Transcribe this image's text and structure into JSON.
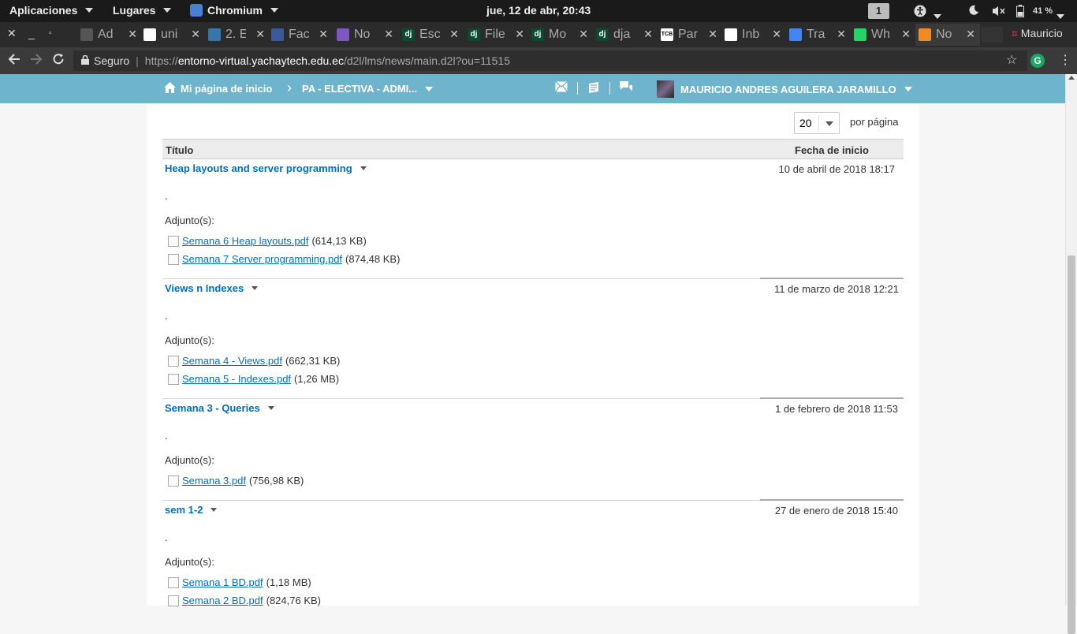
{
  "topbar": {
    "applications": "Aplicaciones",
    "places": "Lugares",
    "app_name": "Chromium",
    "clock": "jue, 12 de abr, 20:43",
    "workspace": "1",
    "battery": "41 %"
  },
  "tabs": [
    {
      "label": "Ad",
      "favicon": "doc-icon",
      "color": "#555"
    },
    {
      "label": "uni",
      "favicon": "google-icon",
      "color": "#fff"
    },
    {
      "label": "2. E",
      "favicon": "python-icon",
      "color": "#3776ab"
    },
    {
      "label": "Fac",
      "favicon": "facebook-icon",
      "color": "#3b5998"
    },
    {
      "label": "No",
      "favicon": "list-icon",
      "color": "#7e57c2"
    },
    {
      "label": "Esc",
      "favicon": "django-icon",
      "color": "#0c4b33"
    },
    {
      "label": "File",
      "favicon": "django-icon",
      "color": "#0c4b33"
    },
    {
      "label": "Mo",
      "favicon": "django-icon",
      "color": "#0c4b33"
    },
    {
      "label": "dja",
      "favicon": "django-icon",
      "color": "#0c4b33"
    },
    {
      "label": "Par",
      "favicon": "tcb-icon",
      "color": "#fff"
    },
    {
      "label": "Inb",
      "favicon": "gmail-icon",
      "color": "#fff"
    },
    {
      "label": "Tra",
      "favicon": "translate-icon",
      "color": "#4285f4"
    },
    {
      "label": "Wh",
      "favicon": "whatsapp-icon",
      "color": "#25d366"
    },
    {
      "label": "No",
      "favicon": "d2l-icon",
      "color": "#f08a24"
    }
  ],
  "profile_name": "Mauricio",
  "omnibox": {
    "secure_label": "Seguro",
    "url_scheme": "https://",
    "url_host": "entorno-virtual.yachaytech.edu.ec",
    "url_path": "/d2l/lms/news/main.d2l?ou=11515"
  },
  "d2l": {
    "home_label": "Mi página de inicio",
    "course_label": "PA - ELECTIVA - ADMI...",
    "user_name": "MAURICIO ANDRES AGUILERA JARAMILLO"
  },
  "pager": {
    "value": "20",
    "label": "por página"
  },
  "table": {
    "col_title": "Título",
    "col_date": "Fecha de inicio"
  },
  "news": [
    {
      "title": "Heap layouts and server programming",
      "date": "10 de abril de 2018 18:17",
      "body": ".",
      "attachments_label": "Adjunto(s):",
      "attachments": [
        {
          "name": "Semana 6 Heap layouts.pdf",
          "size": "(614,13 KB)"
        },
        {
          "name": "Semana 7 Server programming.pdf",
          "size": "(874,48 KB)"
        }
      ]
    },
    {
      "title": "Views n Indexes",
      "date": "11 de marzo de 2018 12:21",
      "body": ".",
      "attachments_label": "Adjunto(s):",
      "attachments": [
        {
          "name": "Semana 4 - Views.pdf",
          "size": "(662,31 KB)"
        },
        {
          "name": "Semana 5 - Indexes.pdf",
          "size": "(1,26 MB)"
        }
      ]
    },
    {
      "title": "Semana 3 - Queries",
      "date": "1 de febrero de 2018 11:53",
      "body": ".",
      "attachments_label": "Adjunto(s):",
      "attachments": [
        {
          "name": "Semana 3.pdf",
          "size": "(756,98 KB)"
        }
      ]
    },
    {
      "title": "sem 1-2",
      "date": "27 de enero de 2018 15:40",
      "body": ".",
      "attachments_label": "Adjunto(s):",
      "attachments": [
        {
          "name": "Semana 1 BD.pdf",
          "size": "(1,18 MB)"
        },
        {
          "name": "Semana 2 BD.pdf",
          "size": "(824,76 KB)"
        }
      ]
    }
  ]
}
